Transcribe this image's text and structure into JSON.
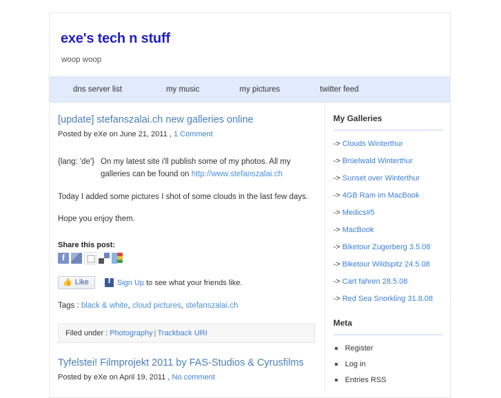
{
  "site": {
    "title": "exe's tech n stuff",
    "tagline": "woop woop"
  },
  "nav": {
    "items": [
      {
        "label": "dns server list"
      },
      {
        "label": "my music"
      },
      {
        "label": "my pictures"
      },
      {
        "label": "twitter feed"
      }
    ]
  },
  "posts": [
    {
      "title": "[update] stefanszalai.ch new galleries online",
      "meta_prefix": "Posted by eXe on June 21, 2011 ,",
      "comment_link": "1 Comment",
      "lang_tag": "{lang: 'de'}",
      "lang_text_before": "On my latest site i'll publish some of my photos. All my galleries can be found on ",
      "lang_link": "http://www.stefanszalai.ch",
      "paragraph_1": "Today I added some pictures I shot of some clouds in the last few days.",
      "paragraph_2": "Hope you enjoy them.",
      "share_heading": "Share this post:",
      "share_icons": [
        {
          "name": "facebook-share-icon"
        },
        {
          "name": "myspace-share-icon"
        },
        {
          "name": "digg-share-icon"
        },
        {
          "name": "delicious-share-icon"
        },
        {
          "name": "google-share-icon"
        }
      ],
      "like_label": "Like",
      "like_signup": "Sign Up",
      "like_note_rest": " to see what your friends like.",
      "tags_label": "Tags :",
      "tags": [
        {
          "label": "black & white"
        },
        {
          "label": "cloud pictures"
        },
        {
          "label": "stefanszalai.ch"
        }
      ],
      "filed_label": "Filed under :",
      "filed_category": "Photography",
      "filed_separator": "|",
      "trackback_label": "Trackback URI"
    },
    {
      "title": "Tyfelstei! Filmprojekt 2011 by FAS-Studios & Cyrusfilms",
      "meta_prefix": "Posted by eXe on April 19, 2011 ,",
      "comment_link": "No comment"
    }
  ],
  "sidebar": {
    "galleries_heading": "My Galleries",
    "galleries": [
      {
        "arrow": "->",
        "label": "Clouds Winterthur"
      },
      {
        "arrow": "->",
        "label": "Brüelwald Winterthur"
      },
      {
        "arrow": "->",
        "label": "Sunset over Winterthur"
      },
      {
        "arrow": "->",
        "label": "4GB Ram im MacBook"
      },
      {
        "arrow": "->",
        "label": "Medics#5"
      },
      {
        "arrow": "->",
        "label": "MacBook"
      },
      {
        "arrow": "->",
        "label": "Biketour Zugerberg 3.5.08"
      },
      {
        "arrow": "->",
        "label": "Biketour Wildspitz 24.5.08"
      },
      {
        "arrow": "->",
        "label": "Cart fahren 28.5.08"
      },
      {
        "arrow": "->",
        "label": "Red Sea Snorkling 31.8.08"
      }
    ],
    "meta_heading": "Meta",
    "meta_items": [
      {
        "label": "Register"
      },
      {
        "label": "Log in"
      },
      {
        "label": "Entries RSS"
      }
    ]
  },
  "colors": {
    "title": "#2020c0",
    "nav_bg": "#e2ebfb",
    "link": "#3b7fd4",
    "post_title": "#4a7ebb"
  }
}
